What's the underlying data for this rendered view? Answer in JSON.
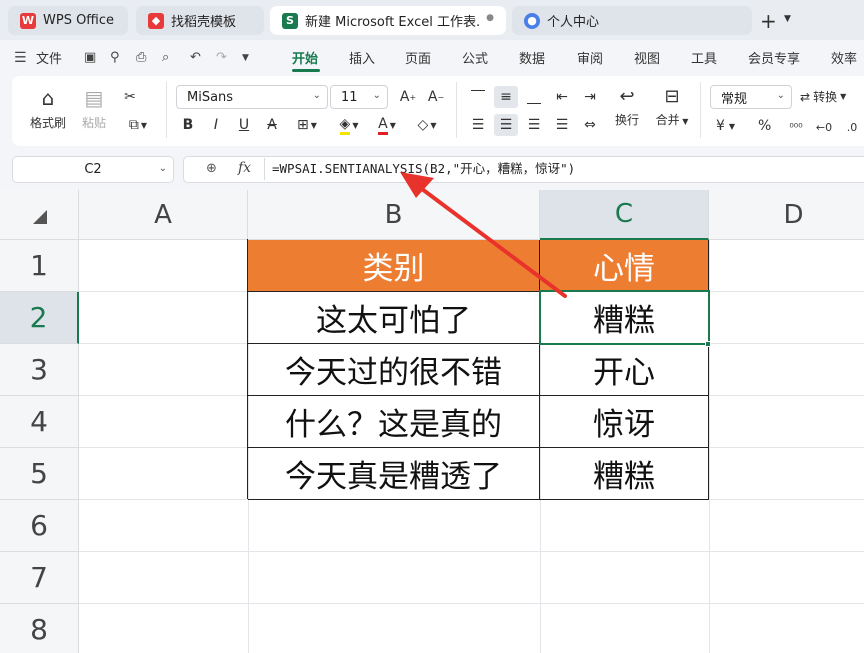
{
  "tabs": [
    {
      "label": "WPS Office",
      "icon": "wps-logo-icon",
      "color": "#e83a3a"
    },
    {
      "label": "找稻壳模板",
      "icon": "docer-logo-icon",
      "color": "#e83a3a"
    },
    {
      "label": "新建 Microsoft Excel 工作表.",
      "icon": "excel-s-icon",
      "color": "#1a7a4f"
    },
    {
      "label": "个人中心",
      "icon": "user-icon",
      "color": "#4a7ee8"
    }
  ],
  "menu": {
    "file": "文件",
    "items": [
      "开始",
      "插入",
      "页面",
      "公式",
      "数据",
      "审阅",
      "视图",
      "工具",
      "会员专享",
      "效率"
    ],
    "active": "开始"
  },
  "ribbon": {
    "format_painter": "格式刷",
    "paste": "粘贴",
    "font_name": "MiSans",
    "font_size": "11",
    "wrap": "换行",
    "merge": "合并",
    "number_format": "常规",
    "convert": "转换",
    "currency": "¥",
    "percent": "%"
  },
  "formula_bar": {
    "name_box": "C2",
    "fx": "fx",
    "formula": "=WPSAI.SENTIANALYSIS(B2,\"开心，糟糕，惊讶\")"
  },
  "sheet": {
    "columns": [
      "A",
      "B",
      "C",
      "D"
    ],
    "rows": [
      "1",
      "2",
      "3",
      "4",
      "5",
      "6",
      "7",
      "8"
    ],
    "header_color": "#ed7d31",
    "accent": "#1a7a4f",
    "table": {
      "headers": [
        "类别",
        "心情"
      ],
      "rows": [
        [
          "这太可怕了",
          "糟糕"
        ],
        [
          "今天过的很不错",
          "开心"
        ],
        [
          "什么？这是真的",
          "惊讶"
        ],
        [
          "今天真是糟透了",
          "糟糕"
        ]
      ]
    },
    "selected_cell": "C2"
  }
}
